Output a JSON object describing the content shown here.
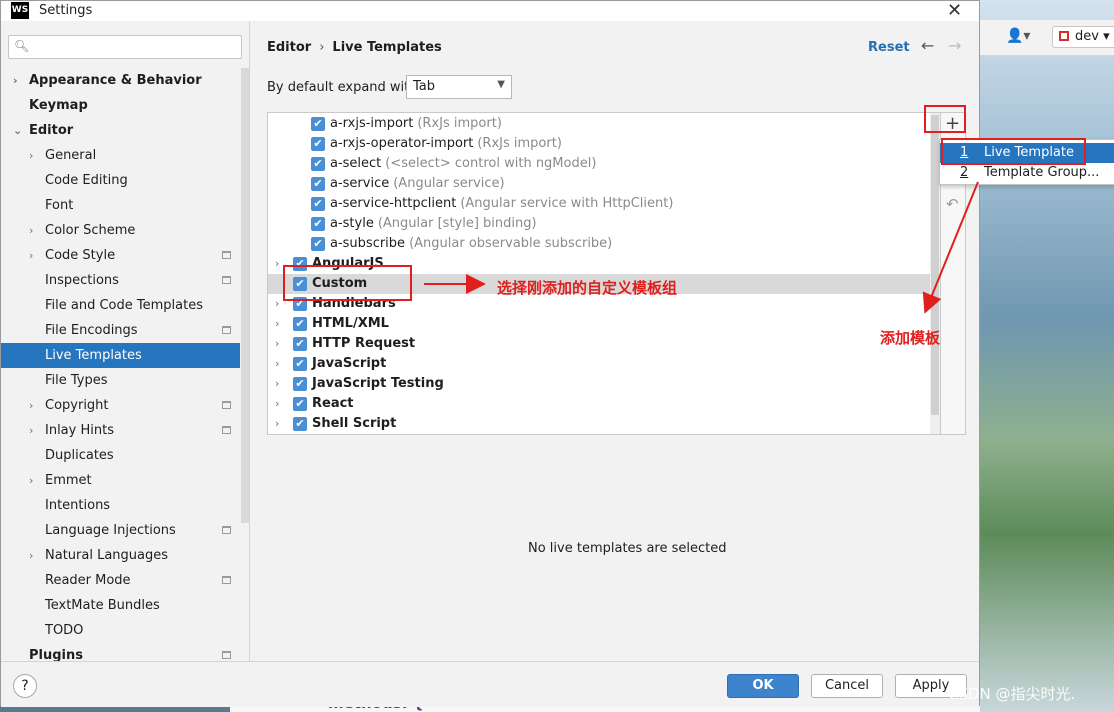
{
  "window": {
    "title": "Settings",
    "app_logo": "WS"
  },
  "background": {
    "branch": "dev",
    "code_snippet": "methods: {"
  },
  "sidebar": {
    "search_placeholder": "",
    "items": [
      {
        "label": "Appearance & Behavior",
        "bold": true,
        "arrow": "›",
        "level": 0
      },
      {
        "label": "Keymap",
        "bold": true,
        "arrow": "",
        "level": 0
      },
      {
        "label": "Editor",
        "bold": true,
        "arrow": "⌄",
        "level": 0
      },
      {
        "label": "General",
        "arrow": "›",
        "level": 1
      },
      {
        "label": "Code Editing",
        "arrow": "",
        "level": 1
      },
      {
        "label": "Font",
        "arrow": "",
        "level": 1
      },
      {
        "label": "Color Scheme",
        "arrow": "›",
        "level": 1
      },
      {
        "label": "Code Style",
        "arrow": "›",
        "level": 1,
        "gear": true
      },
      {
        "label": "Inspections",
        "arrow": "",
        "level": 1,
        "gear": true
      },
      {
        "label": "File and Code Templates",
        "arrow": "",
        "level": 1
      },
      {
        "label": "File Encodings",
        "arrow": "",
        "level": 1,
        "gear": true
      },
      {
        "label": "Live Templates",
        "arrow": "",
        "level": 1,
        "selected": true
      },
      {
        "label": "File Types",
        "arrow": "",
        "level": 1
      },
      {
        "label": "Copyright",
        "arrow": "›",
        "level": 1,
        "gear": true
      },
      {
        "label": "Inlay Hints",
        "arrow": "›",
        "level": 1,
        "gear": true
      },
      {
        "label": "Duplicates",
        "arrow": "",
        "level": 1
      },
      {
        "label": "Emmet",
        "arrow": "›",
        "level": 1
      },
      {
        "label": "Intentions",
        "arrow": "",
        "level": 1
      },
      {
        "label": "Language Injections",
        "arrow": "",
        "level": 1,
        "gear": true
      },
      {
        "label": "Natural Languages",
        "arrow": "›",
        "level": 1
      },
      {
        "label": "Reader Mode",
        "arrow": "",
        "level": 1,
        "gear": true
      },
      {
        "label": "TextMate Bundles",
        "arrow": "",
        "level": 1
      },
      {
        "label": "TODO",
        "arrow": "",
        "level": 1
      },
      {
        "label": "Plugins",
        "bold": true,
        "arrow": "",
        "level": 0,
        "gear": true
      }
    ]
  },
  "main": {
    "breadcrumb": {
      "parent": "Editor",
      "separator": "›",
      "current": "Live Templates"
    },
    "reset_label": "Reset",
    "expand_label": "By default expand with",
    "expand_value": "Tab",
    "templates": [
      {
        "name": "a-rxjs-import",
        "desc": "(RxJs import)"
      },
      {
        "name": "a-rxjs-operator-import",
        "desc": "(RxJs import)"
      },
      {
        "name": "a-select",
        "desc": "(<select> control with ngModel)"
      },
      {
        "name": "a-service",
        "desc": "(Angular service)"
      },
      {
        "name": "a-service-httpclient",
        "desc": "(Angular service with HttpClient)"
      },
      {
        "name": "a-style",
        "desc": "(Angular [style] binding)"
      },
      {
        "name": "a-subscribe",
        "desc": "(Angular observable subscribe)"
      }
    ],
    "groups": [
      {
        "name": "AngularJS"
      },
      {
        "name": "Custom",
        "highlight": true,
        "no_arrow": true
      },
      {
        "name": "Handlebars"
      },
      {
        "name": "HTML/XML"
      },
      {
        "name": "HTTP Request"
      },
      {
        "name": "JavaScript"
      },
      {
        "name": "JavaScript Testing"
      },
      {
        "name": "React"
      },
      {
        "name": "Shell Script"
      }
    ],
    "empty_message": "No live templates are selected"
  },
  "popup": {
    "items": [
      {
        "num": "1",
        "label": "Live Template",
        "active": true
      },
      {
        "num": "2",
        "label": "Template Group..."
      }
    ]
  },
  "buttons": {
    "help": "?",
    "ok": "OK",
    "cancel": "Cancel",
    "apply": "Apply"
  },
  "annotations": {
    "select_group": "选择刚添加的自定义模板组",
    "add_template": "添加模板",
    "color": "#e0201f"
  },
  "watermark": "CSDN @指尖时光."
}
